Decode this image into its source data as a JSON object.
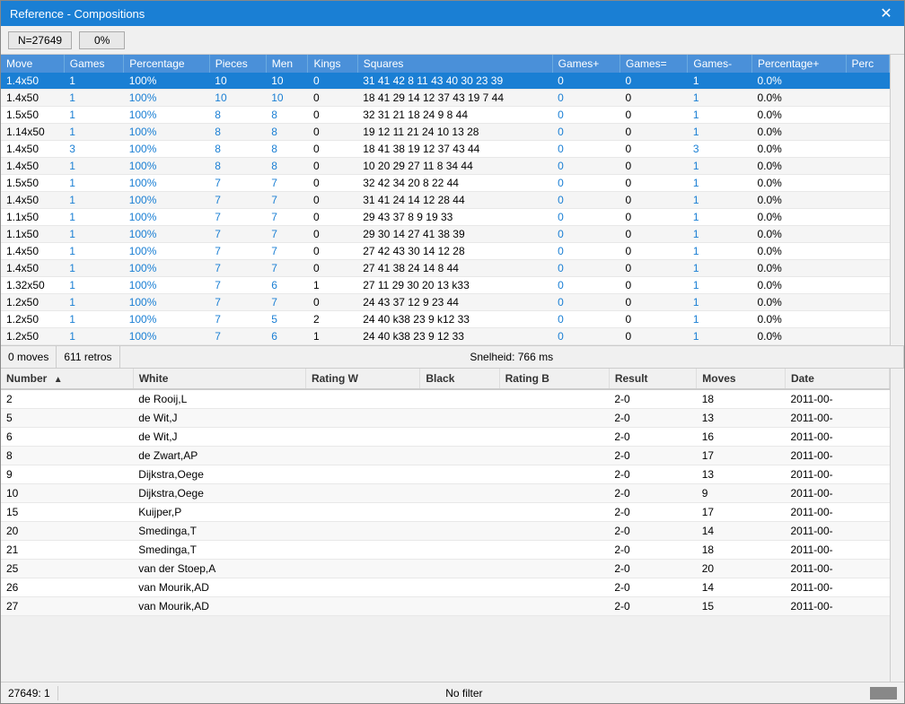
{
  "window": {
    "title": "Reference - Compositions",
    "close_label": "✕"
  },
  "toolbar": {
    "n_label": "N=27649",
    "percent_label": "0%"
  },
  "top_table": {
    "headers": [
      "Move",
      "Games",
      "Percentage",
      "Pieces",
      "Men",
      "Kings",
      "Squares",
      "Games+",
      "Games=",
      "Games-",
      "Percentage+",
      "Perc"
    ],
    "rows": [
      {
        "move": "1.4x50",
        "games": "1",
        "pct": "100%",
        "pieces": "10",
        "men": "10",
        "kings": "0",
        "squares": "31 41 42 8 11 43 40 30 23 39",
        "gplus": "0",
        "geq": "0",
        "gminus": "1",
        "pctplus": "0.0%",
        "selected": true
      },
      {
        "move": "1.4x50",
        "games": "1",
        "pct": "100%",
        "pieces": "10",
        "men": "10",
        "kings": "0",
        "squares": "18 41 29 14 12 37 43 19 7 44",
        "gplus": "0",
        "geq": "0",
        "gminus": "1",
        "pctplus": "0.0%",
        "selected": false
      },
      {
        "move": "1.5x50",
        "games": "1",
        "pct": "100%",
        "pieces": "8",
        "men": "8",
        "kings": "0",
        "squares": "32 31 21 18 24 9 8 44",
        "gplus": "0",
        "geq": "0",
        "gminus": "1",
        "pctplus": "0.0%",
        "selected": false
      },
      {
        "move": "1.14x50",
        "games": "1",
        "pct": "100%",
        "pieces": "8",
        "men": "8",
        "kings": "0",
        "squares": "19 12 11 21 24 10 13 28",
        "gplus": "0",
        "geq": "0",
        "gminus": "1",
        "pctplus": "0.0%",
        "selected": false
      },
      {
        "move": "1.4x50",
        "games": "3",
        "pct": "100%",
        "pieces": "8",
        "men": "8",
        "kings": "0",
        "squares": "18 41 38 19 12 37 43 44",
        "gplus": "0",
        "geq": "0",
        "gminus": "3",
        "pctplus": "0.0%",
        "selected": false
      },
      {
        "move": "1.4x50",
        "games": "1",
        "pct": "100%",
        "pieces": "8",
        "men": "8",
        "kings": "0",
        "squares": "10 20 29 27 11 8 34 44",
        "gplus": "0",
        "geq": "0",
        "gminus": "1",
        "pctplus": "0.0%",
        "selected": false
      },
      {
        "move": "1.5x50",
        "games": "1",
        "pct": "100%",
        "pieces": "7",
        "men": "7",
        "kings": "0",
        "squares": "32 42 34 20 8 22 44",
        "gplus": "0",
        "geq": "0",
        "gminus": "1",
        "pctplus": "0.0%",
        "selected": false
      },
      {
        "move": "1.4x50",
        "games": "1",
        "pct": "100%",
        "pieces": "7",
        "men": "7",
        "kings": "0",
        "squares": "31 41 24 14 12 28 44",
        "gplus": "0",
        "geq": "0",
        "gminus": "1",
        "pctplus": "0.0%",
        "selected": false
      },
      {
        "move": "1.1x50",
        "games": "1",
        "pct": "100%",
        "pieces": "7",
        "men": "7",
        "kings": "0",
        "squares": "29 43 37 8 9 19 33",
        "gplus": "0",
        "geq": "0",
        "gminus": "1",
        "pctplus": "0.0%",
        "selected": false
      },
      {
        "move": "1.1x50",
        "games": "1",
        "pct": "100%",
        "pieces": "7",
        "men": "7",
        "kings": "0",
        "squares": "29 30 14 27 41 38 39",
        "gplus": "0",
        "geq": "0",
        "gminus": "1",
        "pctplus": "0.0%",
        "selected": false
      },
      {
        "move": "1.4x50",
        "games": "1",
        "pct": "100%",
        "pieces": "7",
        "men": "7",
        "kings": "0",
        "squares": "27 42 43 30 14 12 28",
        "gplus": "0",
        "geq": "0",
        "gminus": "1",
        "pctplus": "0.0%",
        "selected": false
      },
      {
        "move": "1.4x50",
        "games": "1",
        "pct": "100%",
        "pieces": "7",
        "men": "7",
        "kings": "0",
        "squares": "27 41 38 24 14 8 44",
        "gplus": "0",
        "geq": "0",
        "gminus": "1",
        "pctplus": "0.0%",
        "selected": false
      },
      {
        "move": "1.32x50",
        "games": "1",
        "pct": "100%",
        "pieces": "7",
        "men": "6",
        "kings": "1",
        "squares": "27 11 29 30 20 13 k33",
        "gplus": "0",
        "geq": "0",
        "gminus": "1",
        "pctplus": "0.0%",
        "selected": false
      },
      {
        "move": "1.2x50",
        "games": "1",
        "pct": "100%",
        "pieces": "7",
        "men": "7",
        "kings": "0",
        "squares": "24 43 37 12 9 23 44",
        "gplus": "0",
        "geq": "0",
        "gminus": "1",
        "pctplus": "0.0%",
        "selected": false
      },
      {
        "move": "1.2x50",
        "games": "1",
        "pct": "100%",
        "pieces": "7",
        "men": "5",
        "kings": "2",
        "squares": "24 40 k38 23 9 k12 33",
        "gplus": "0",
        "geq": "0",
        "gminus": "1",
        "pctplus": "0.0%",
        "selected": false
      },
      {
        "move": "1.2x50",
        "games": "1",
        "pct": "100%",
        "pieces": "7",
        "men": "6",
        "kings": "1",
        "squares": "24 40 k38 23 9 12 33",
        "gplus": "0",
        "geq": "0",
        "gminus": "1",
        "pctplus": "0.0%",
        "selected": false
      }
    ]
  },
  "status_bar": {
    "moves_label": "0 moves",
    "retros_label": "611 retros",
    "speed_label": "Snelheid: 766 ms"
  },
  "bottom_table": {
    "headers": [
      "Number",
      "White",
      "Rating W",
      "Black",
      "Rating B",
      "Result",
      "Moves",
      "Date"
    ],
    "sort_col": "Number",
    "sort_dir": "asc",
    "rows": [
      {
        "number": "2",
        "white": "de Rooij,L",
        "rating_w": "",
        "black": "",
        "rating_b": "",
        "result": "2-0",
        "moves": "18",
        "date": "2011-00-"
      },
      {
        "number": "5",
        "white": "de Wit,J",
        "rating_w": "",
        "black": "",
        "rating_b": "",
        "result": "2-0",
        "moves": "13",
        "date": "2011-00-"
      },
      {
        "number": "6",
        "white": "de Wit,J",
        "rating_w": "",
        "black": "",
        "rating_b": "",
        "result": "2-0",
        "moves": "16",
        "date": "2011-00-"
      },
      {
        "number": "8",
        "white": "de Zwart,AP",
        "rating_w": "",
        "black": "",
        "rating_b": "",
        "result": "2-0",
        "moves": "17",
        "date": "2011-00-"
      },
      {
        "number": "9",
        "white": "Dijkstra,Oege",
        "rating_w": "",
        "black": "",
        "rating_b": "",
        "result": "2-0",
        "moves": "13",
        "date": "2011-00-"
      },
      {
        "number": "10",
        "white": "Dijkstra,Oege",
        "rating_w": "",
        "black": "",
        "rating_b": "",
        "result": "2-0",
        "moves": "9",
        "date": "2011-00-"
      },
      {
        "number": "15",
        "white": "Kuijper,P",
        "rating_w": "",
        "black": "",
        "rating_b": "",
        "result": "2-0",
        "moves": "17",
        "date": "2011-00-"
      },
      {
        "number": "20",
        "white": "Smedinga,T",
        "rating_w": "",
        "black": "",
        "rating_b": "",
        "result": "2-0",
        "moves": "14",
        "date": "2011-00-"
      },
      {
        "number": "21",
        "white": "Smedinga,T",
        "rating_w": "",
        "black": "",
        "rating_b": "",
        "result": "2-0",
        "moves": "18",
        "date": "2011-00-"
      },
      {
        "number": "25",
        "white": "van der Stoep,A",
        "rating_w": "",
        "black": "",
        "rating_b": "",
        "result": "2-0",
        "moves": "20",
        "date": "2011-00-"
      },
      {
        "number": "26",
        "white": "van Mourik,AD",
        "rating_w": "",
        "black": "",
        "rating_b": "",
        "result": "2-0",
        "moves": "14",
        "date": "2011-00-"
      },
      {
        "number": "27",
        "white": "van Mourik,AD",
        "rating_w": "",
        "black": "",
        "rating_b": "",
        "result": "2-0",
        "moves": "15",
        "date": "2011-00-"
      }
    ]
  },
  "bottom_status": {
    "count_label": "27649: 1",
    "filter_label": "No filter"
  }
}
